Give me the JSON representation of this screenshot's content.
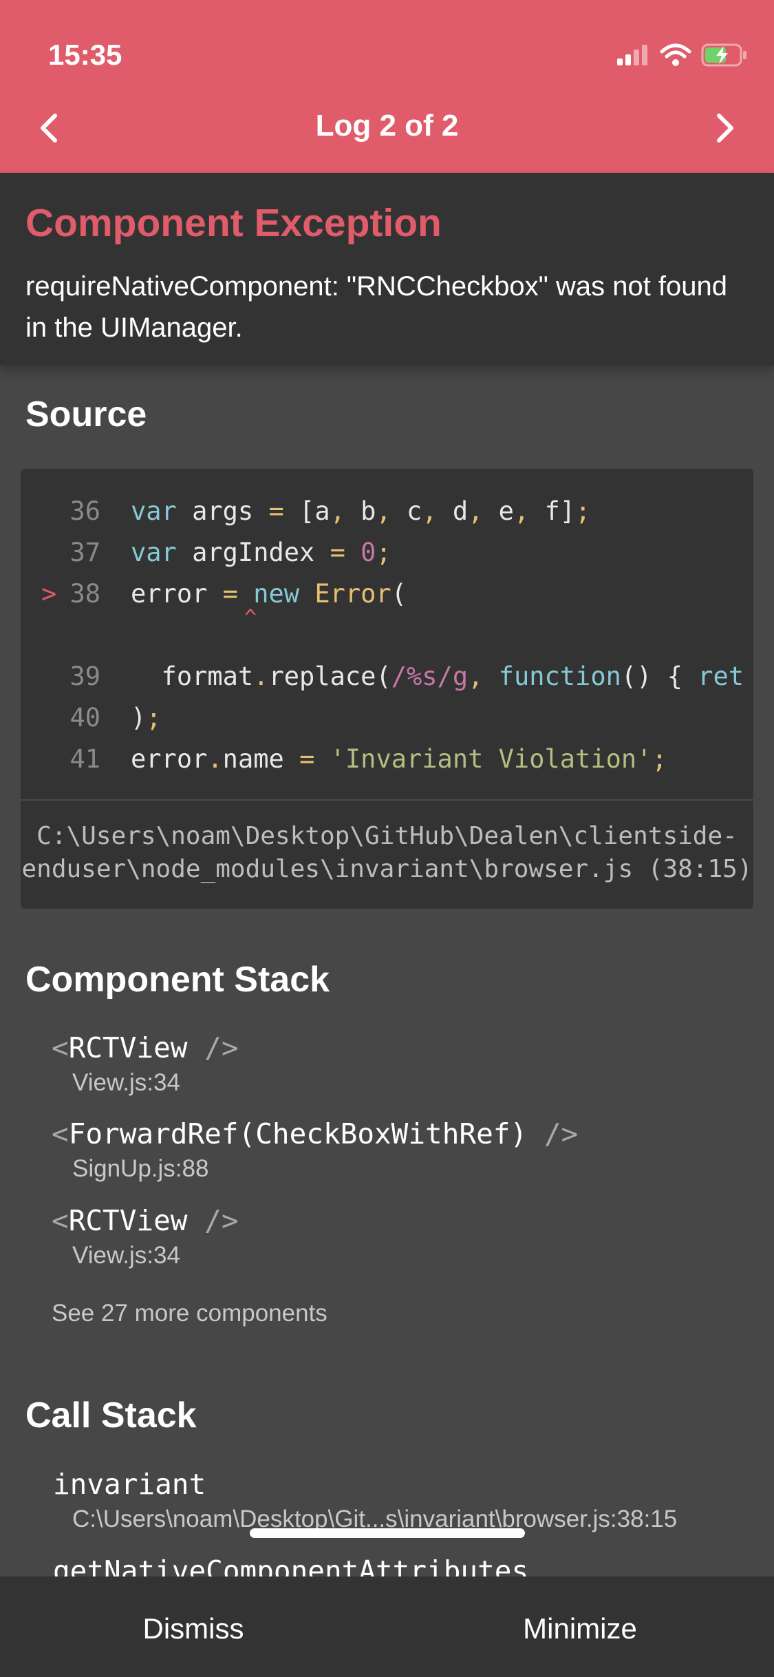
{
  "status_bar": {
    "time": "15:35"
  },
  "nav": {
    "title": "Log 2 of 2"
  },
  "exception": {
    "title": "Component Exception",
    "message": "requireNativeComponent: \"RNCCheckbox\" was not found in the UIManager."
  },
  "source": {
    "heading": "Source",
    "lines": [
      {
        "num": "36",
        "marker": ""
      },
      {
        "num": "37",
        "marker": ""
      },
      {
        "num": "38",
        "marker": ">"
      },
      {
        "num": "39",
        "marker": ""
      },
      {
        "num": "40",
        "marker": ""
      },
      {
        "num": "41",
        "marker": ""
      }
    ],
    "caret": "^",
    "file_path": "C:\\Users\\noam\\Desktop\\GitHub\\Dealen\\clientside-\nenduser\\node_modules\\invariant\\browser.js (38:15)"
  },
  "component_stack": {
    "heading": "Component Stack",
    "items": [
      {
        "name": "RCTView",
        "file": "View.js:34"
      },
      {
        "name": "ForwardRef(CheckBoxWithRef)",
        "file": "SignUp.js:88"
      },
      {
        "name": "RCTView",
        "file": "View.js:34"
      }
    ],
    "see_more": "See 27 more components"
  },
  "call_stack": {
    "heading": "Call Stack",
    "items": [
      {
        "name": "invariant",
        "file": "C:\\Users\\noam\\Desktop\\Git...s\\invariant\\browser.js:38:15"
      },
      {
        "name": "getNativeComponentAttributes",
        "file": ""
      }
    ]
  },
  "footer": {
    "dismiss_label": "Dismiss",
    "minimize_label": "Minimize"
  },
  "colors": {
    "accent": "#e15c6a",
    "panel": "#333333",
    "background": "#474747"
  }
}
